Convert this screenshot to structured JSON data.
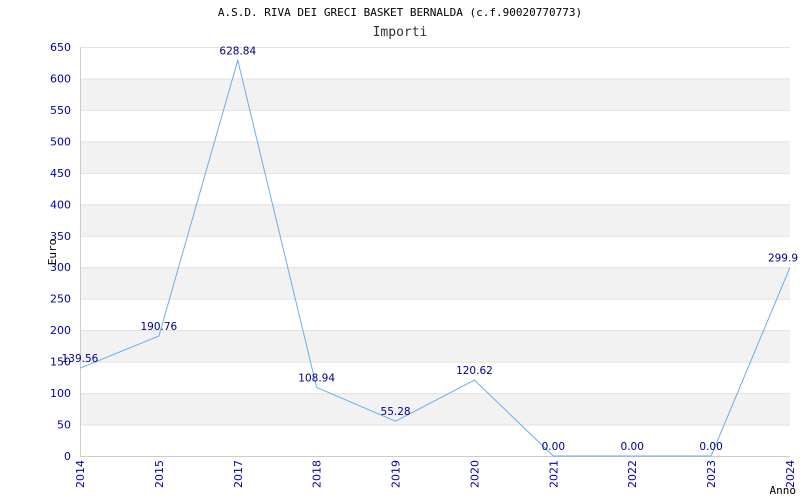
{
  "chart_data": {
    "type": "line",
    "title": "A.S.D. RIVA DEI GRECI BASKET BERNALDA (c.f.90020770773)",
    "subtitle": "Importi",
    "xlabel": "Anno",
    "ylabel": "Euro",
    "x": [
      "2014",
      "2015",
      "2017",
      "2018",
      "2019",
      "2020",
      "2021",
      "2022",
      "2023",
      "2024"
    ],
    "values": [
      139.56,
      190.76,
      628.84,
      108.94,
      55.28,
      120.62,
      0.0,
      0.0,
      0.0,
      299.9
    ],
    "data_labels": [
      "139.56",
      "190.76",
      "628.84",
      "108.94",
      "55.28",
      "120.62",
      "0.00",
      "0.00",
      "0.00",
      "299.9"
    ],
    "ylim": [
      0,
      650
    ],
    "yticks": [
      0,
      50,
      100,
      150,
      200,
      250,
      300,
      350,
      400,
      450,
      500,
      550,
      600,
      650
    ],
    "grid": "horizontal alternating bands",
    "colors": {
      "line": "#6aaee8",
      "band": "#f2f2f2",
      "tick_text": "#0000aa",
      "data_label": "#000080"
    }
  }
}
